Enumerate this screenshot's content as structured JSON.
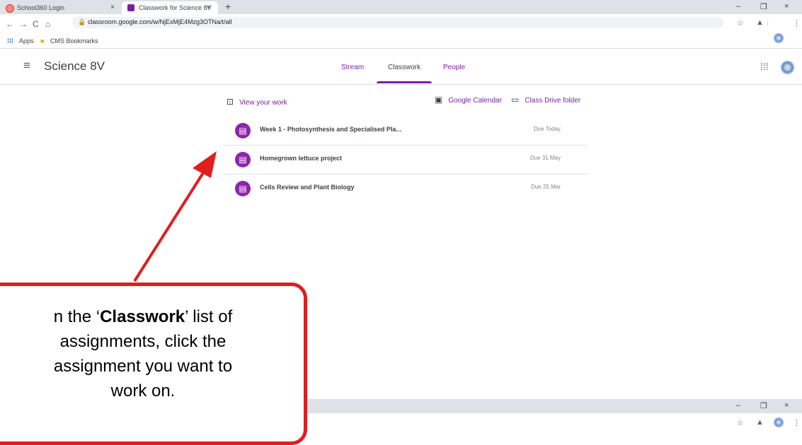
{
  "browser": {
    "tabs": [
      {
        "title": "School360 Login",
        "close": "×",
        "active": false
      },
      {
        "title": "Classwork for Science 8V",
        "close": "×",
        "active": true
      }
    ],
    "new_tab": "+",
    "window_controls": {
      "minimize": "–",
      "restore": "❐",
      "close": "×"
    },
    "url": "classroom.google.com/w/NjExMjE4Mzg3OTNa/t/all",
    "bookmarks": [
      {
        "label": "Apps"
      },
      {
        "label": "CMS Bookmarks"
      }
    ]
  },
  "app": {
    "class_name": "Science 8V",
    "nav_tabs": [
      {
        "label": "Stream"
      },
      {
        "label": "Classwork"
      },
      {
        "label": "People"
      }
    ],
    "active_tab": "Classwork",
    "accent_color": "#7b1fa2"
  },
  "actions": {
    "view_work": "View your work",
    "calendar": "Google Calendar",
    "drive": "Class Drive folder"
  },
  "assignments": [
    {
      "title": "Week 1 - Photosynthesis and Specialised Pla...",
      "due": "Due Today"
    },
    {
      "title": "Homegrown lettuce project",
      "due": "Due 31 May"
    },
    {
      "title": "Cells Review and Plant Biology",
      "due": "Due 25 Mar"
    }
  ],
  "callout": {
    "line1_prefix": "n the ‘",
    "line1_bold": "Classwork",
    "line1_suffix": "’ list of",
    "line2": "assignments, click the",
    "line3": "assignment you want to",
    "line4": "work on."
  },
  "icons": {
    "hamburger": "menu-icon",
    "apps_grid": "apps-grid-icon",
    "assignment": "assignment-icon"
  }
}
